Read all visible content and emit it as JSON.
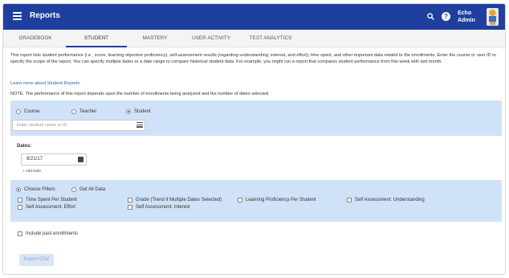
{
  "header": {
    "title": "Reports",
    "user_line1": "Echo",
    "user_line2": "Admin",
    "help_glyph": "?"
  },
  "tabs": [
    {
      "label": "GRADEBOOK"
    },
    {
      "label": "STUDENT",
      "active": true
    },
    {
      "label": "MASTERY"
    },
    {
      "label": "USER ACTIVITY"
    },
    {
      "label": "TEST ANALYTICS"
    }
  ],
  "intro": "This report lists student performance (i.e., score, learning objective proficiency), self-assessment results (regarding understanding, interest, and effort), time spent, and other important data related to the enrollments. Enter the course or user ID to specify the scope of the report. You can specify multiple dates or a date range to compare historical student data. For example, you might run a report that compares student performance from this week with last month.",
  "learn_link": "Learn more about Student Reports.",
  "note": "NOTE: The performance of this report depends upon the number of enrollments being analyzed and the number of dates selected.",
  "scope": {
    "options": [
      "Course",
      "Teacher",
      "Student"
    ],
    "selected": "Student",
    "placeholder": "Enter student name or ID"
  },
  "dates": {
    "label": "Dates:",
    "value": "8/21/17",
    "add_label": "Add Date",
    "add_glyph": "+"
  },
  "filters": {
    "choose_label": "Choose Filters",
    "get_all_label": "Get All Data",
    "options": [
      "Time Spent Per Student",
      "Grade (Trend if Multiple Dates Selected)",
      "Learning Proficiency Per Student",
      "Self Assessment: Understanding",
      "Self Assessment: Effort",
      "Self Assessment: Interest"
    ]
  },
  "include_past": "Include past enrollments",
  "export_label": "Export CSV",
  "colors": {
    "header_bg": "#1f3f9e",
    "panel_bg": "#cfe2f7",
    "link": "#2a5db0"
  }
}
